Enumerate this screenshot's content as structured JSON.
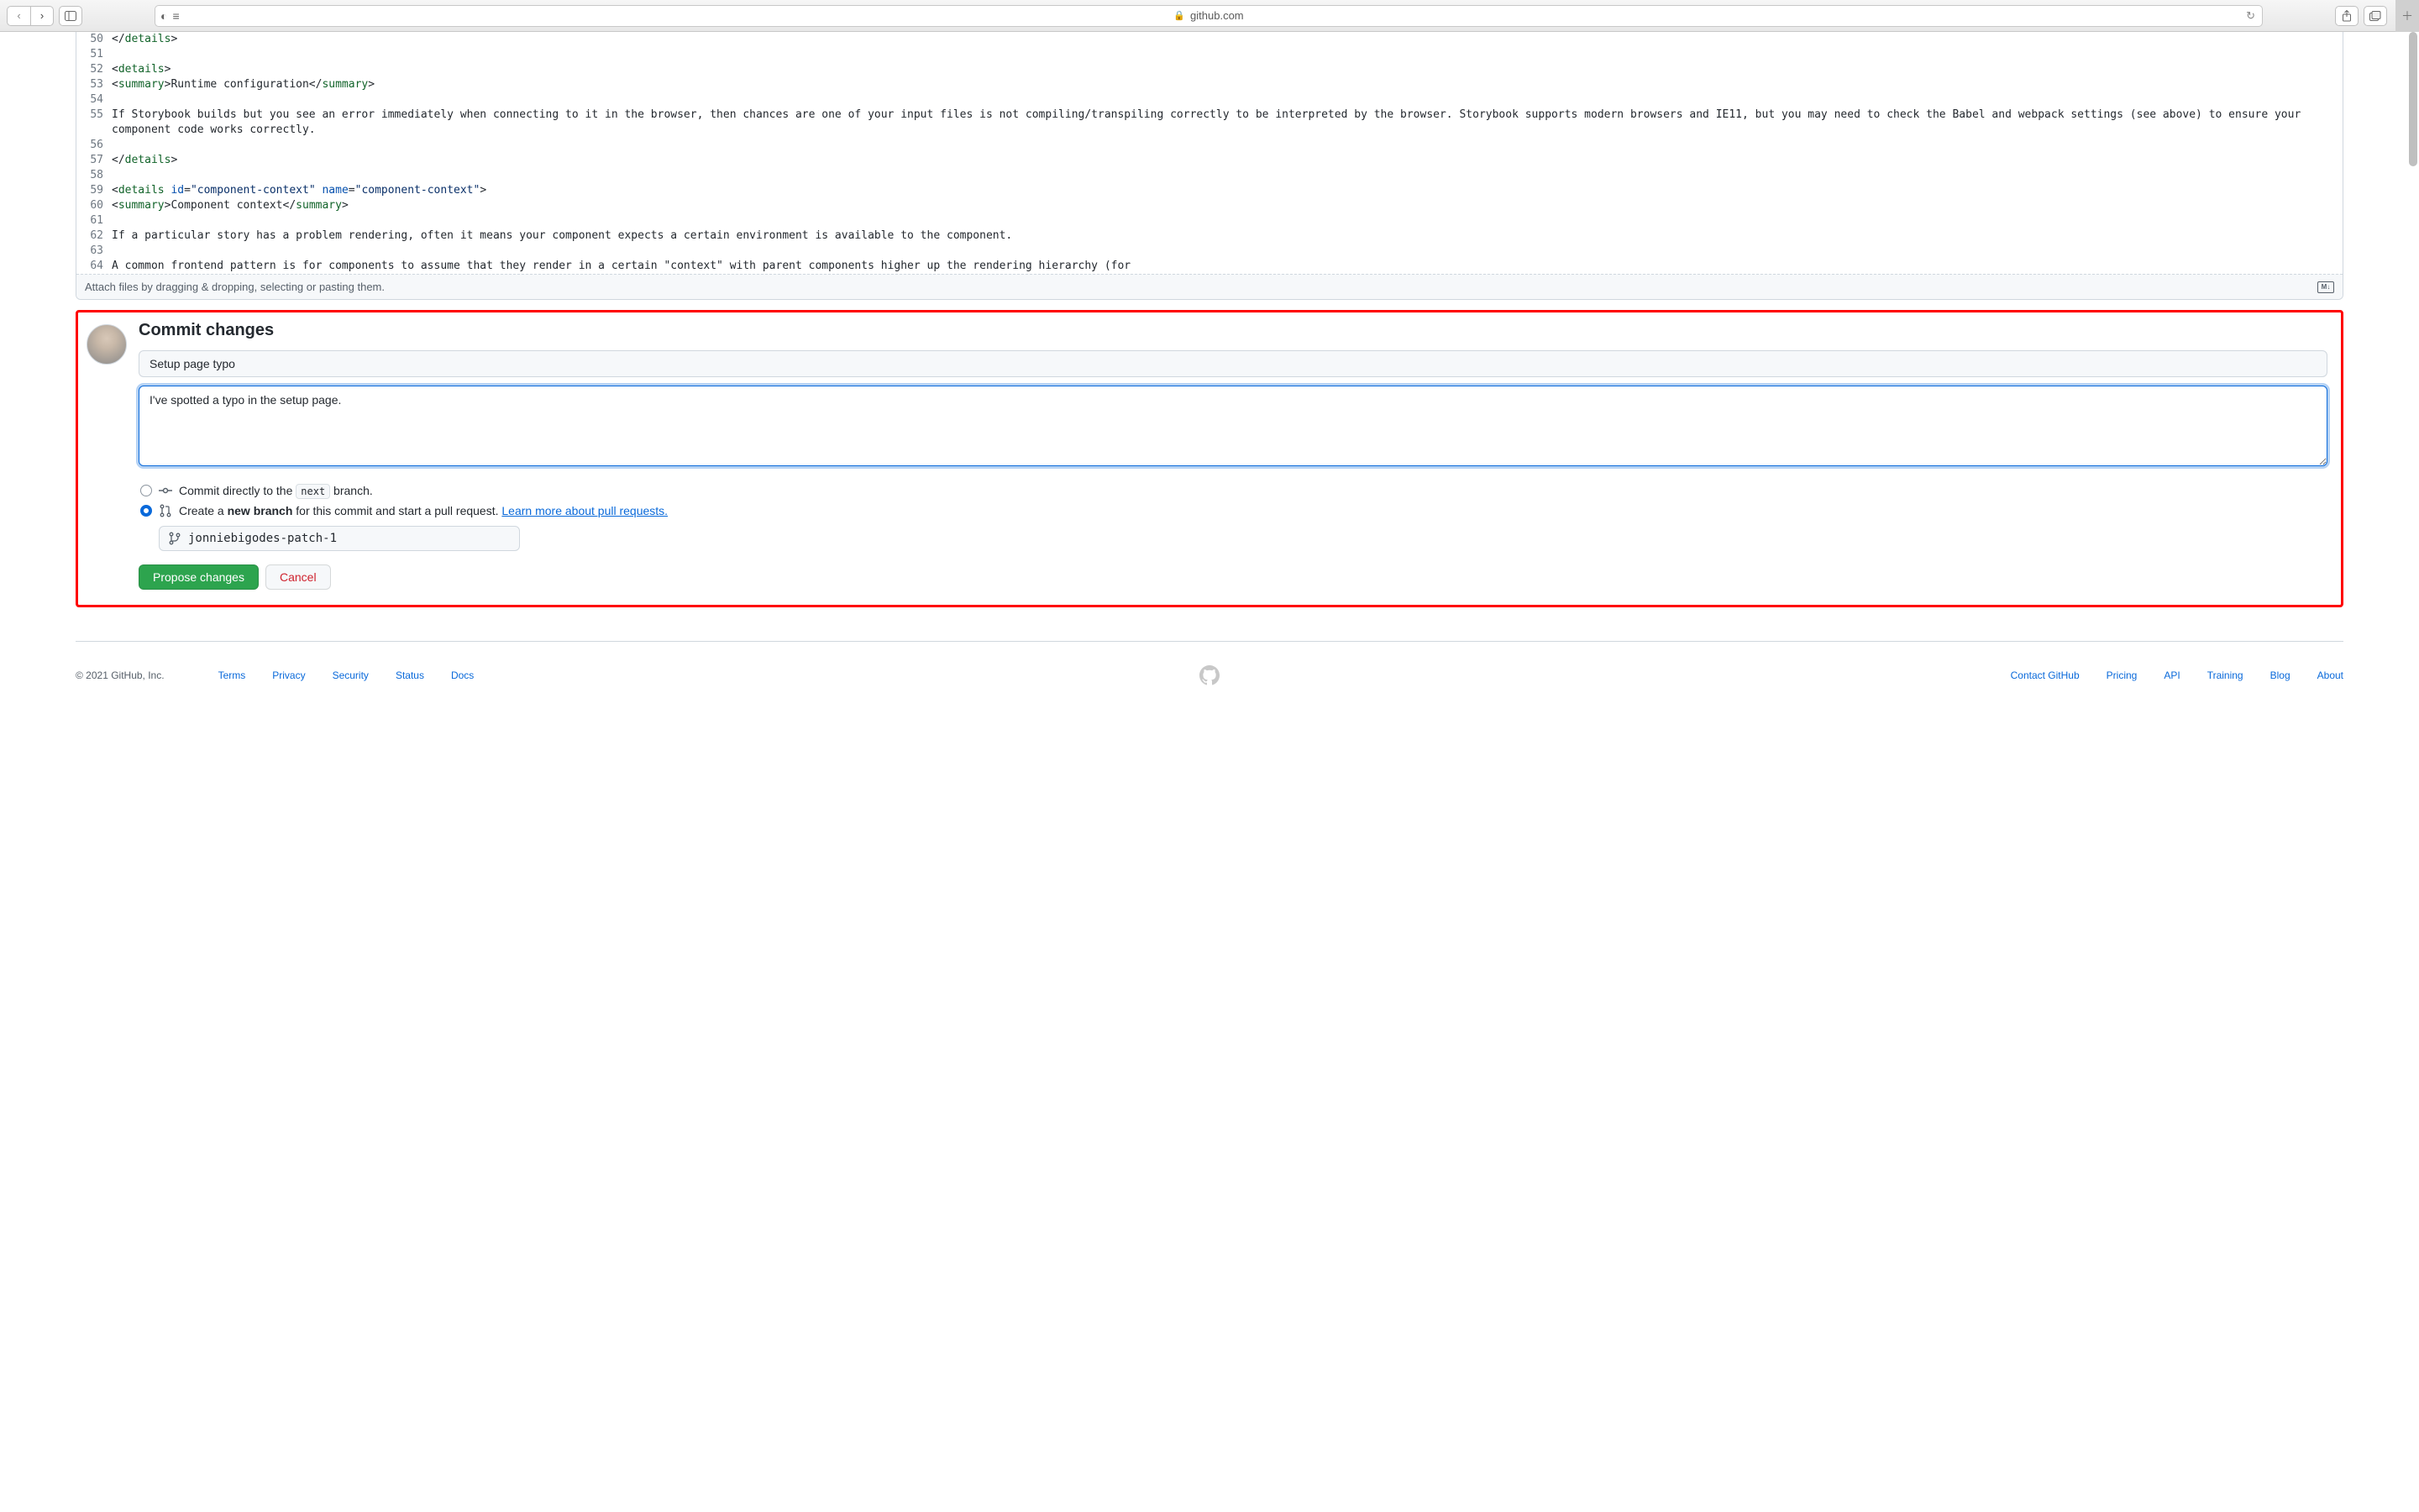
{
  "browser": {
    "url_host": "github.com"
  },
  "code": {
    "lines": [
      {
        "n": 50,
        "html": "&lt;/<span class='tag-name'>details</span>&gt;"
      },
      {
        "n": 51,
        "html": ""
      },
      {
        "n": 52,
        "html": "&lt;<span class='tag-name'>details</span>&gt;"
      },
      {
        "n": 53,
        "html": "&lt;<span class='tag-name'>summary</span>&gt;Runtime configuration&lt;/<span class='tag-name'>summary</span>&gt;"
      },
      {
        "n": 54,
        "html": ""
      },
      {
        "n": 55,
        "html": "If Storybook builds but you see an error immediately when connecting to it in the browser, then chances are one of your input files is not compiling/transpiling correctly to be interpreted by the browser. Storybook supports modern browsers and IE11, but you may need to check the Babel and webpack settings (see above) to ensure your component code works correctly."
      },
      {
        "n": 56,
        "html": ""
      },
      {
        "n": 57,
        "html": "&lt;/<span class='tag-name'>details</span>&gt;"
      },
      {
        "n": 58,
        "html": ""
      },
      {
        "n": 59,
        "html": "&lt;<span class='tag-name'>details</span> <span class='attr-name'>id</span>=<span class='string-q'>\"component-context\"</span> <span class='attr-name'>name</span>=<span class='string-q'>\"component-context\"</span>&gt;"
      },
      {
        "n": 60,
        "html": "&lt;<span class='tag-name'>summary</span>&gt;Component context&lt;/<span class='tag-name'>summary</span>&gt;"
      },
      {
        "n": 61,
        "html": ""
      },
      {
        "n": 62,
        "html": "If a particular story has a problem rendering, often it means your component expects a certain environment is available to the component."
      },
      {
        "n": 63,
        "html": ""
      },
      {
        "n": 64,
        "html": "A common frontend pattern is for components to assume that they render in a certain \"context\" with parent components higher up the rendering hierarchy (for"
      }
    ],
    "attach_hint": "Attach files by dragging & dropping, selecting or pasting them."
  },
  "commit": {
    "heading": "Commit changes",
    "summary_value": "Setup page typo",
    "description_value": "I've spotted a typo in the setup page.",
    "radio_direct_pre": "Commit directly to the ",
    "radio_direct_branch": "next",
    "radio_direct_post": " branch.",
    "radio_newbranch_pre": "Create a ",
    "radio_newbranch_bold": "new branch",
    "radio_newbranch_mid": " for this commit and start a pull request. ",
    "radio_newbranch_link": "Learn more about pull requests.",
    "branch_input_value": "jonniebigodes-patch-1",
    "propose_label": "Propose changes",
    "cancel_label": "Cancel"
  },
  "footer": {
    "copyright": "© 2021 GitHub, Inc.",
    "left_links": [
      "Terms",
      "Privacy",
      "Security",
      "Status",
      "Docs"
    ],
    "right_links": [
      "Contact GitHub",
      "Pricing",
      "API",
      "Training",
      "Blog",
      "About"
    ]
  }
}
